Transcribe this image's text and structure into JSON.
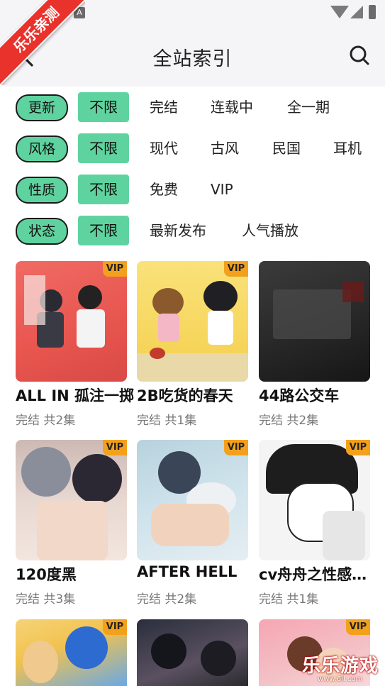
{
  "status_bar": {
    "a_icon": "A"
  },
  "header": {
    "title": "全站索引",
    "back_icon": "chevron-left-icon",
    "search_icon": "search-icon"
  },
  "ribbon": {
    "text": "乐乐亲测"
  },
  "filters": [
    {
      "label": "更新",
      "active": "不限",
      "options": [
        "完结",
        "连载中",
        "全一期"
      ]
    },
    {
      "label": "风格",
      "active": "不限",
      "options": [
        "现代",
        "古风",
        "民国",
        "耳机"
      ]
    },
    {
      "label": "性质",
      "active": "不限",
      "options": [
        "免费",
        "VIP"
      ]
    },
    {
      "label": "状态",
      "active": "不限",
      "options": [
        "最新发布",
        "人气播放"
      ]
    }
  ],
  "items": [
    {
      "title": "ALL IN 孤注一掷",
      "sub": "完结 共2集",
      "badge": "VIP"
    },
    {
      "title": "2B吃货的春天",
      "sub": "完结 共1集",
      "badge": "VIP"
    },
    {
      "title": "44路公交车",
      "sub": "完结 共2集",
      "badge": ""
    },
    {
      "title": "120度黑",
      "sub": "完结 共3集",
      "badge": "VIP"
    },
    {
      "title": "AFTER HELL",
      "sub": "完结 共2集",
      "badge": "VIP"
    },
    {
      "title": "cv舟舟之性感男人",
      "sub": "完结 共1集",
      "badge": "VIP"
    },
    {
      "title": "",
      "sub": "",
      "badge": "VIP"
    },
    {
      "title": "",
      "sub": "",
      "badge": ""
    },
    {
      "title": "",
      "sub": "",
      "badge": "VIP"
    }
  ],
  "watermark": {
    "text": "乐乐游戏",
    "url": "www.6ll.com"
  },
  "colors": {
    "accent_green": "#5fd39f",
    "vip_orange": "#f3a11c",
    "ribbon_red": "#e8322b"
  }
}
